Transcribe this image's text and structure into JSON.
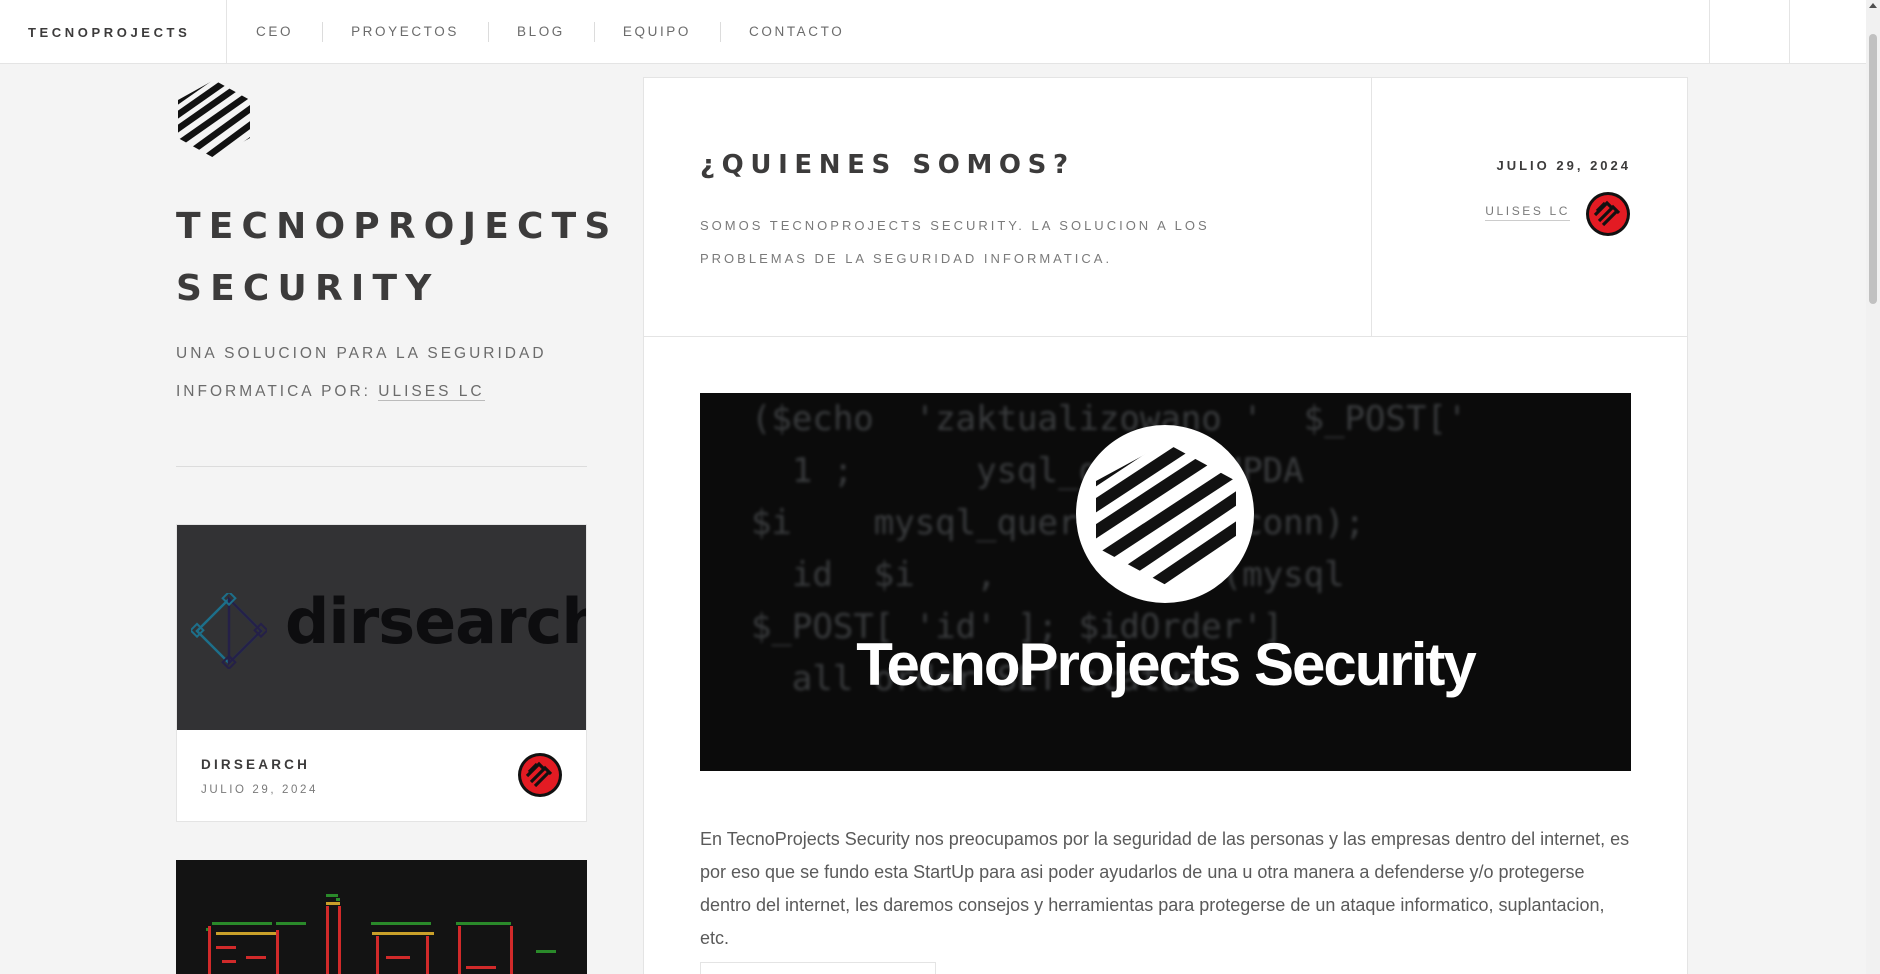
{
  "brand": "TECNOPROJECTS",
  "nav": [
    {
      "label": "CEO"
    },
    {
      "label": "PROYECTOS"
    },
    {
      "label": "BLOG"
    },
    {
      "label": "EQUIPO"
    },
    {
      "label": "CONTACTO"
    }
  ],
  "sidebar": {
    "title_line1": "TECNOPROJECTS",
    "title_line2": "SECURITY",
    "desc_text": "UNA SOLUCION PARA LA SEGURIDAD INFORMATICA POR: ",
    "desc_link": "ULISES LC"
  },
  "cards": [
    {
      "title": "DIRSEARCH",
      "date": "JULIO 29, 2024",
      "thumb_text": "dirsearch"
    }
  ],
  "post": {
    "title": "¿QUIENES SOMOS?",
    "subtitle": "SOMOS TECNOPROJECTS SECURITY. LA SOLUCION A LOS PROBLEMAS DE LA SEGURIDAD INFORMATICA.",
    "date": "JULIO 29, 2024",
    "author": "ULISES LC",
    "hero_text": "TecnoProjects Security",
    "hero_code": "  ($echo  'zaktualizowano '  $_POST['\n    1 ;      ysql_query(\"UPDA\n  $i    mysql_query(\"   ($conn);\n    id  $i   ,      ;  if(mysql\n  $_POST[ 'id' ]; $idOrder']\n    all order SET status",
    "body": "En TecnoProjects Security nos preocupamos por la seguridad de las personas y las empresas dentro del internet, es por eso que se fundo esta StartUp para asi poder ayudarlos de una u otra manera a defenderse y/o protegerse dentro del internet, les daremos consejos y herramientas para protegerse de un ataque informatico, suplantacion, etc."
  },
  "colors": {
    "accent_red": "#e31b23",
    "text_dark": "#3c3b3b",
    "background": "#f4f4f4"
  }
}
